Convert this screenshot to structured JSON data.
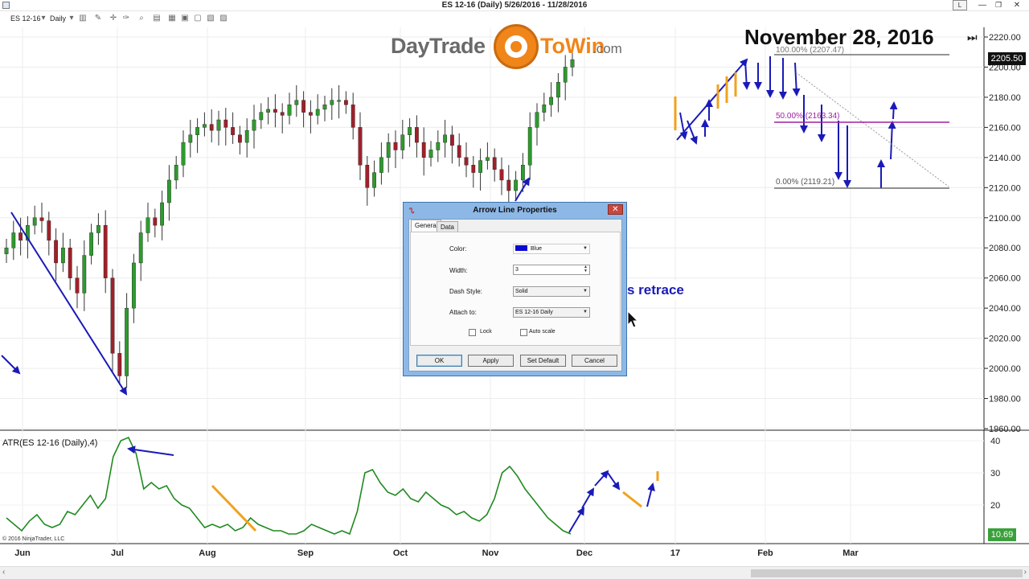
{
  "window": {
    "title": "ES 12-16 (Daily)  5/26/2016 - 11/28/2016",
    "btn_layout": "L",
    "btn_minimize": "—",
    "btn_maximize": "❐",
    "btn_close": "✕"
  },
  "toolbar": {
    "instrument": "ES 12-16",
    "interval": "Daily"
  },
  "logo": {
    "part1": "DayTrade",
    "part2": "ToWin",
    "part3": ".com"
  },
  "overlay": {
    "date_title": "November 28, 2016",
    "retrace_text": "s retrace",
    "skip_icon": "⏭"
  },
  "price_axis": {
    "last_price": "2205.50",
    "atr_last": "10.69"
  },
  "atr_panel": {
    "label": "ATR(ES 12-16 (Daily),4)",
    "copyright": "© 2016 NinjaTrader, LLC"
  },
  "fib": {
    "level_100": "100.00% (2207.47)",
    "level_50": "50.00% (2163.34)",
    "level_0": "0.00% (2119.21)"
  },
  "dialog": {
    "title": "Arrow Line Properties",
    "tabs": [
      "General",
      "Data"
    ],
    "color_label": "Color:",
    "color_value": "Blue",
    "width_label": "Width:",
    "width_value": "3",
    "dash_label": "Dash Style:",
    "dash_value": "Solid",
    "attach_label": "Attach to:",
    "attach_value": "ES 12-16 Daily",
    "lock_label": "Lock",
    "autoscale_label": "Auto scale",
    "ok": "OK",
    "apply": "Apply",
    "set_default": "Set Default",
    "cancel": "Cancel"
  },
  "colors": {
    "drawing_blue": "#1a1ab8",
    "drawing_orange": "#f0a21c",
    "atr_line": "#1f8a1f",
    "fib_50": "#a020a0",
    "candle_up": "#2e9a2e",
    "candle_down": "#a0202a"
  },
  "chart_data": {
    "type": "candlestick",
    "title": "ES 12-16 (Daily)  5/26/2016 - 11/28/2016",
    "x_ticks": [
      "Jun",
      "Jul",
      "Aug",
      "Sep",
      "Oct",
      "Nov",
      "Dec",
      "17",
      "Feb",
      "Mar"
    ],
    "y_ticks": [
      1960,
      1980,
      2000,
      2020,
      2040,
      2060,
      2080,
      2100,
      2120,
      2140,
      2160,
      2180,
      2200,
      2220
    ],
    "ylim": [
      1960,
      2225
    ],
    "close_series": [
      2080,
      2090,
      2085,
      2095,
      2100,
      2098,
      2085,
      2070,
      2080,
      2060,
      2050,
      2075,
      2090,
      2095,
      2060,
      2010,
      1995,
      2040,
      2070,
      2090,
      2100,
      2095,
      2110,
      2125,
      2135,
      2150,
      2155,
      2160,
      2162,
      2158,
      2165,
      2160,
      2155,
      2150,
      2158,
      2165,
      2170,
      2172,
      2170,
      2168,
      2175,
      2178,
      2170,
      2168,
      2172,
      2175,
      2178,
      2178,
      2175,
      2160,
      2135,
      2120,
      2130,
      2140,
      2150,
      2145,
      2155,
      2160,
      2150,
      2140,
      2145,
      2150,
      2155,
      2148,
      2140,
      2135,
      2130,
      2138,
      2140,
      2132,
      2125,
      2118,
      2125,
      2135,
      2160,
      2170,
      2175,
      2180,
      2190,
      2200,
      2205
    ],
    "y2_ticks": [
      20,
      30,
      40
    ],
    "atr_ylim": [
      9,
      41
    ],
    "atr_series": [
      16,
      14,
      12,
      15,
      17,
      14,
      13,
      14,
      18,
      17,
      20,
      23,
      19,
      22,
      35,
      40,
      41,
      36,
      25,
      27,
      25,
      26,
      22,
      20,
      19,
      16,
      13,
      14,
      13,
      14,
      12,
      13,
      16,
      14,
      13,
      12,
      12,
      11,
      11,
      12,
      14,
      13,
      12,
      11,
      12,
      11,
      18,
      30,
      31,
      27,
      24,
      23,
      25,
      22,
      21,
      24,
      22,
      20,
      19,
      17,
      18,
      16,
      15,
      17,
      22,
      30,
      32,
      29,
      25,
      22,
      19,
      16,
      14,
      12,
      11
    ]
  }
}
